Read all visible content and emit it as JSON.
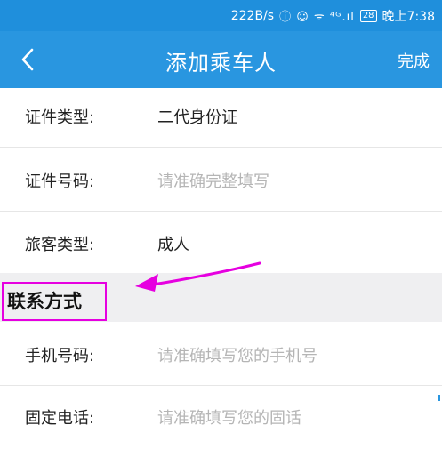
{
  "status_bar": {
    "speed": "222B/s",
    "icons_text": "ⓘ ☺ ᯤ ⁴ᴳ.ıl",
    "battery": "28",
    "time": "晚上7:38"
  },
  "navbar": {
    "back_icon": "chevron-left-icon",
    "title": "添加乘车人",
    "done_label": "完成"
  },
  "form": {
    "id_type": {
      "label": "证件类型:",
      "value": "二代身份证"
    },
    "id_number": {
      "label": "证件号码:",
      "placeholder": "请准确完整填写"
    },
    "passenger_type": {
      "label": "旅客类型:",
      "value": "成人"
    },
    "contact_section": {
      "title": "联系方式"
    },
    "mobile": {
      "label": "手机号码:",
      "placeholder": "请准确填写您的手机号"
    },
    "landline": {
      "label": "固定电话:",
      "placeholder": "请准确填写您的固话"
    }
  },
  "annotation": {
    "arrow_color": "#e600e0"
  },
  "colors": {
    "nav_bar": "#2996e0",
    "status_bar": "#1f8fdc",
    "highlight": "#e600e0"
  }
}
